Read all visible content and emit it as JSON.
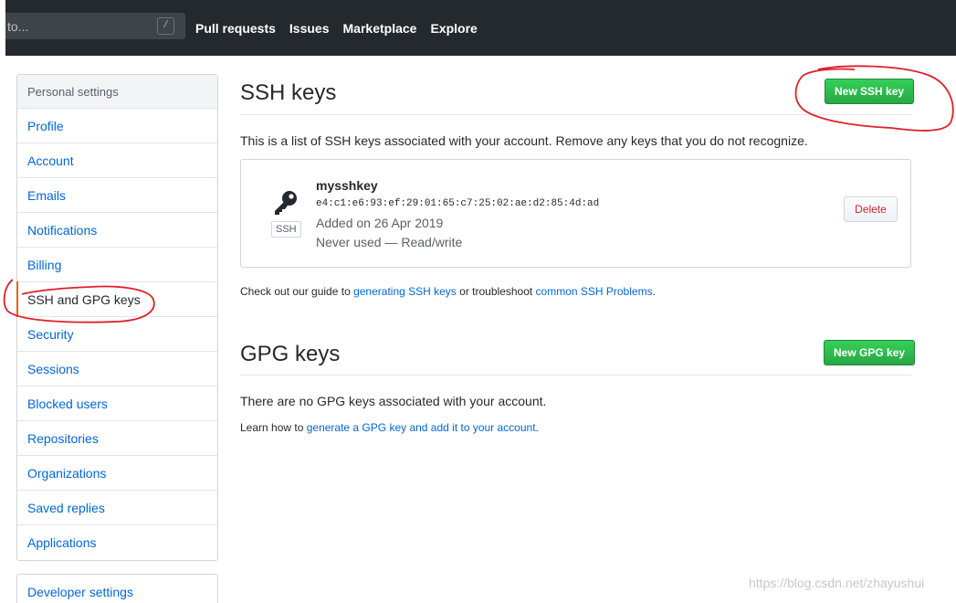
{
  "header": {
    "search_placeholder": "Search or jump to...",
    "search_visible_fragment": "to...",
    "slash_key": "/",
    "nav": [
      "Pull requests",
      "Issues",
      "Marketplace",
      "Explore"
    ]
  },
  "sidebar": {
    "heading": "Personal settings",
    "items": [
      {
        "label": "Profile"
      },
      {
        "label": "Account"
      },
      {
        "label": "Emails"
      },
      {
        "label": "Notifications"
      },
      {
        "label": "Billing"
      },
      {
        "label": "SSH and GPG keys",
        "selected": true
      },
      {
        "label": "Security"
      },
      {
        "label": "Sessions"
      },
      {
        "label": "Blocked users"
      },
      {
        "label": "Repositories"
      },
      {
        "label": "Organizations"
      },
      {
        "label": "Saved replies"
      },
      {
        "label": "Applications"
      }
    ],
    "developer_settings": "Developer settings"
  },
  "ssh": {
    "title": "SSH keys",
    "new_button": "New SSH key",
    "description": "This is a list of SSH keys associated with your account. Remove any keys that you do not recognize.",
    "key": {
      "name": "mysshkey",
      "fingerprint": "e4:c1:e6:93:ef:29:01:65:c7:25:02:ae:d2:85:4d:ad",
      "added": "Added on 26 Apr 2019",
      "usage": "Never used — Read/write",
      "badge": "SSH",
      "delete_label": "Delete"
    },
    "guide": {
      "prefix": "Check out our guide to ",
      "link1": "generating SSH keys",
      "middle": " or troubleshoot ",
      "link2": "common SSH Problems",
      "suffix": "."
    }
  },
  "gpg": {
    "title": "GPG keys",
    "new_button": "New GPG key",
    "empty": "There are no GPG keys associated with your account.",
    "learn": {
      "prefix": "Learn how to ",
      "link": "generate a GPG key and add it to your account",
      "suffix": "."
    }
  },
  "watermark": "https://blog.csdn.net/zhayushui",
  "colors": {
    "header_bg": "#24292e",
    "link": "#0366d6",
    "green": "#28a745",
    "selected_marker": "#e36209",
    "annotation_red": "#e0202a",
    "danger": "#cb2431"
  }
}
